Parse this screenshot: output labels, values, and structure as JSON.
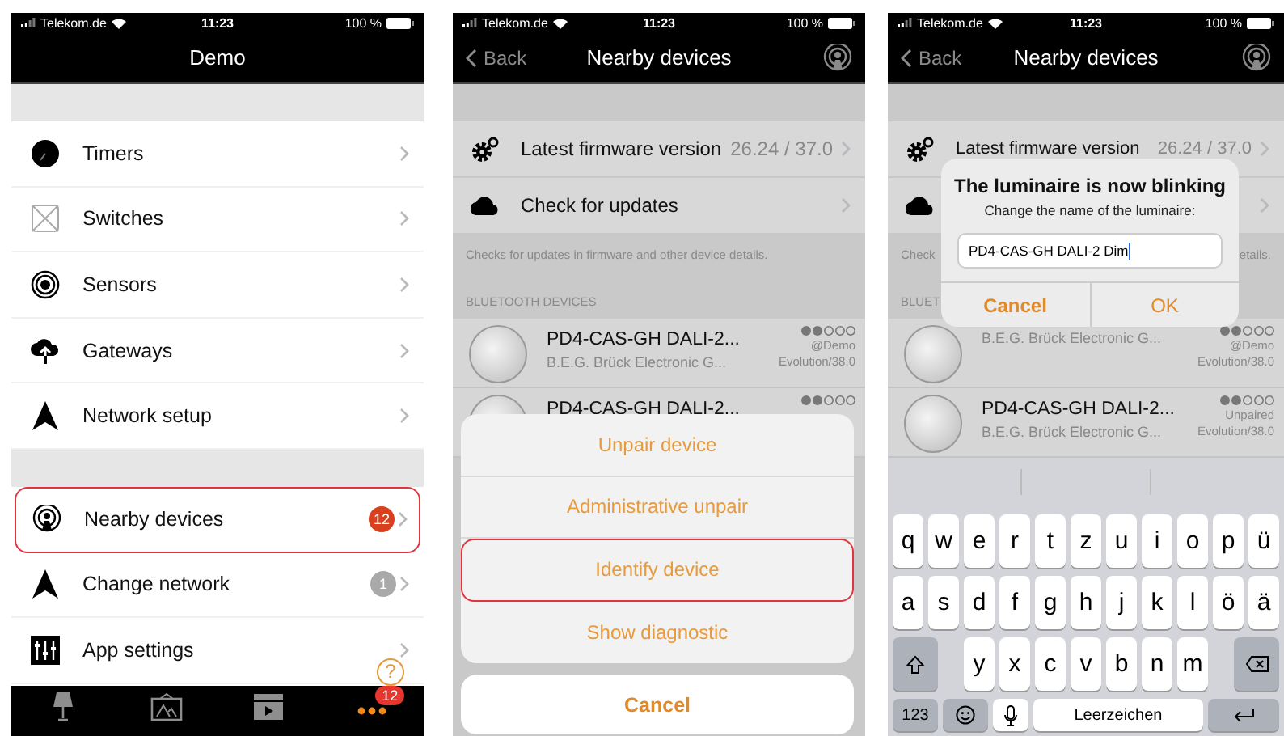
{
  "demo_screen": {
    "status_bar": {
      "carrier": "Telekom.de",
      "time": "11:23",
      "battery": "100 %"
    },
    "title": "Demo",
    "sections": [
      [
        {
          "label": "Timers",
          "highlighted": false
        },
        {
          "label": "Switches",
          "highlighted": false
        },
        {
          "label": "Sensors",
          "highlighted": false
        },
        {
          "label": "Gateways",
          "highlighted": false
        },
        {
          "label": "Network setup",
          "highlighted": false
        }
      ],
      [
        {
          "label": "Nearby devices",
          "highlighted": true,
          "badge": "12",
          "muted": false
        },
        {
          "label": "Change network",
          "highlighted": false,
          "badge": "1",
          "muted": true
        },
        {
          "label": "App settings",
          "highlighted": false,
          "help": "?"
        }
      ]
    ],
    "tab_bar": [
      {
        "selected": false
      },
      {
        "selected": false
      },
      {
        "selected": false
      },
      {
        "selected": true,
        "badge": "12"
      }
    ]
  },
  "nearby_devices_screen": {
    "status_bar": {
      "carrier": "Telekom.de",
      "time": "11:23",
      "battery": "100 %"
    },
    "back": "Back",
    "title": "Nearby devices",
    "settings_rows": [
      {
        "label": "Latest firmware version",
        "value": "26.24 / 37.0"
      },
      {
        "label": "Check for updates"
      }
    ],
    "footer": "Checks for updates in firmware and other device details.",
    "section_header": "BLUETOOTH DEVICES",
    "devices": [
      {
        "name": "PD4-CAS-GH DALI-2...",
        "vendor": "B.E.G. Brück Electronic G...",
        "status": "@Demo",
        "version": "Evolution/38.0"
      },
      {
        "name": "PD4-CAS-GH DALI-2..."
      }
    ],
    "action_sheet": {
      "actions": [
        {
          "label": "Unpair device",
          "highlighted": false
        },
        {
          "label": "Administrative unpair",
          "highlighted": false
        },
        {
          "label": "Identify device",
          "highlighted": true
        },
        {
          "label": "Show diagnostic",
          "highlighted": false
        }
      ],
      "cancel": "Cancel"
    }
  },
  "rename_screen": {
    "status_bar": {
      "carrier": "Telekom.de",
      "time": "11:23",
      "battery": "100 %"
    },
    "back": "Back",
    "title": "Nearby devices",
    "firmware_row": {
      "label": "Latest firmware version",
      "value": "26.24 / 37.0"
    },
    "footer_left": "Check",
    "footer_right": "etails.",
    "section_header": "BLUET",
    "devices": [
      {
        "vendor": "B.E.G. Brück Electronic G...",
        "status": "@Demo",
        "version": "Evolution/38.0"
      },
      {
        "name": "PD4-CAS-GH DALI-2...",
        "vendor": "B.E.G. Brück Electronic G...",
        "status": "Unpaired",
        "version": "Evolution/38.0"
      }
    ],
    "dialog": {
      "title": "The luminaire is now blinking",
      "message": "Change the name of the luminaire:",
      "value": "PD4-CAS-GH DALI-2 Dim",
      "buttons": [
        "Cancel",
        "OK"
      ]
    },
    "keyboard": {
      "top_row": [
        "q",
        "w",
        "e",
        "r",
        "t",
        "z",
        "u",
        "i",
        "o",
        "p",
        "ü"
      ],
      "middle_row": [
        "a",
        "s",
        "d",
        "f",
        "g",
        "h",
        "j",
        "k",
        "l",
        "ö",
        "ä"
      ],
      "bottom_row": [
        "y",
        "x",
        "c",
        "v",
        "b",
        "n",
        "m"
      ],
      "numbers": "123",
      "space": "Leerzeichen"
    }
  }
}
